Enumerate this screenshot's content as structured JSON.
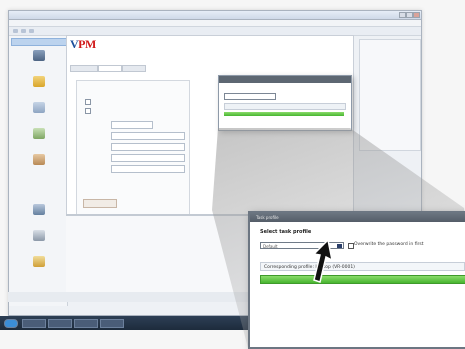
{
  "window": {
    "title": ""
  },
  "logo": {
    "text_v": "V",
    "text_pm": "PM",
    "color_v": "#1b4f9c",
    "color_pm": "#d11b1b"
  },
  "zoom_dialog": {
    "title": "Task profile",
    "subtitle": "Select task profile",
    "select_value": "Default",
    "checkbox_label": "Overwrite the password in first",
    "info_text": "Corresponding profile: Laptop (VR-0001)"
  },
  "colors": {
    "progress": "#48b530",
    "title_bar": "#545d68"
  },
  "icons": [
    "computer-icon",
    "folder-icon",
    "document-icon",
    "network-icon",
    "user-icon",
    "settings-icon",
    "mouse-cursor-icon"
  ]
}
